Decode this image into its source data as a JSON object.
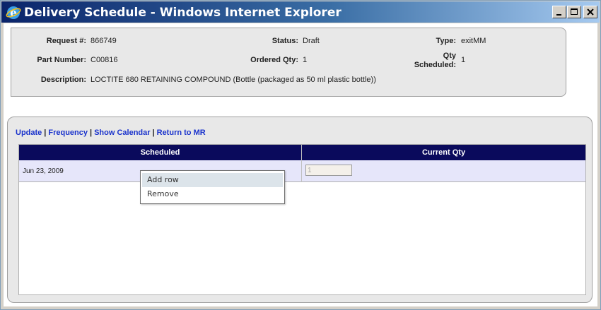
{
  "window": {
    "title": "Delivery Schedule - Windows Internet Explorer"
  },
  "header": {
    "request_label": "Request #:",
    "request_value": "866749",
    "status_label": "Status:",
    "status_value": "Draft",
    "type_label": "Type:",
    "type_value": "exitMM",
    "part_label": "Part Number:",
    "part_value": "C00816",
    "ordered_label": "Ordered Qty:",
    "ordered_value": "1",
    "qty_sched_label_1": "Qty",
    "qty_sched_label_2": "Scheduled:",
    "qty_sched_value": "1",
    "desc_label": "Description:",
    "desc_value": "LOCTITE 680 RETAINING COMPOUND (Bottle (packaged as 50 ml plastic bottle))"
  },
  "links": {
    "update": "Update",
    "frequency": "Frequency",
    "show_calendar": "Show Calendar",
    "return_mr": "Return to MR",
    "sep": "|"
  },
  "table": {
    "columns": [
      "Scheduled",
      "Current Qty"
    ],
    "rows": [
      {
        "scheduled": "Jun 23, 2009",
        "current_qty": "1"
      }
    ]
  },
  "context_menu": {
    "items": [
      "Add row",
      "Remove"
    ]
  },
  "colors": {
    "header_bg": "#0a0a5c",
    "row_bg": "#e6e6fa",
    "link": "#1a33cc"
  }
}
